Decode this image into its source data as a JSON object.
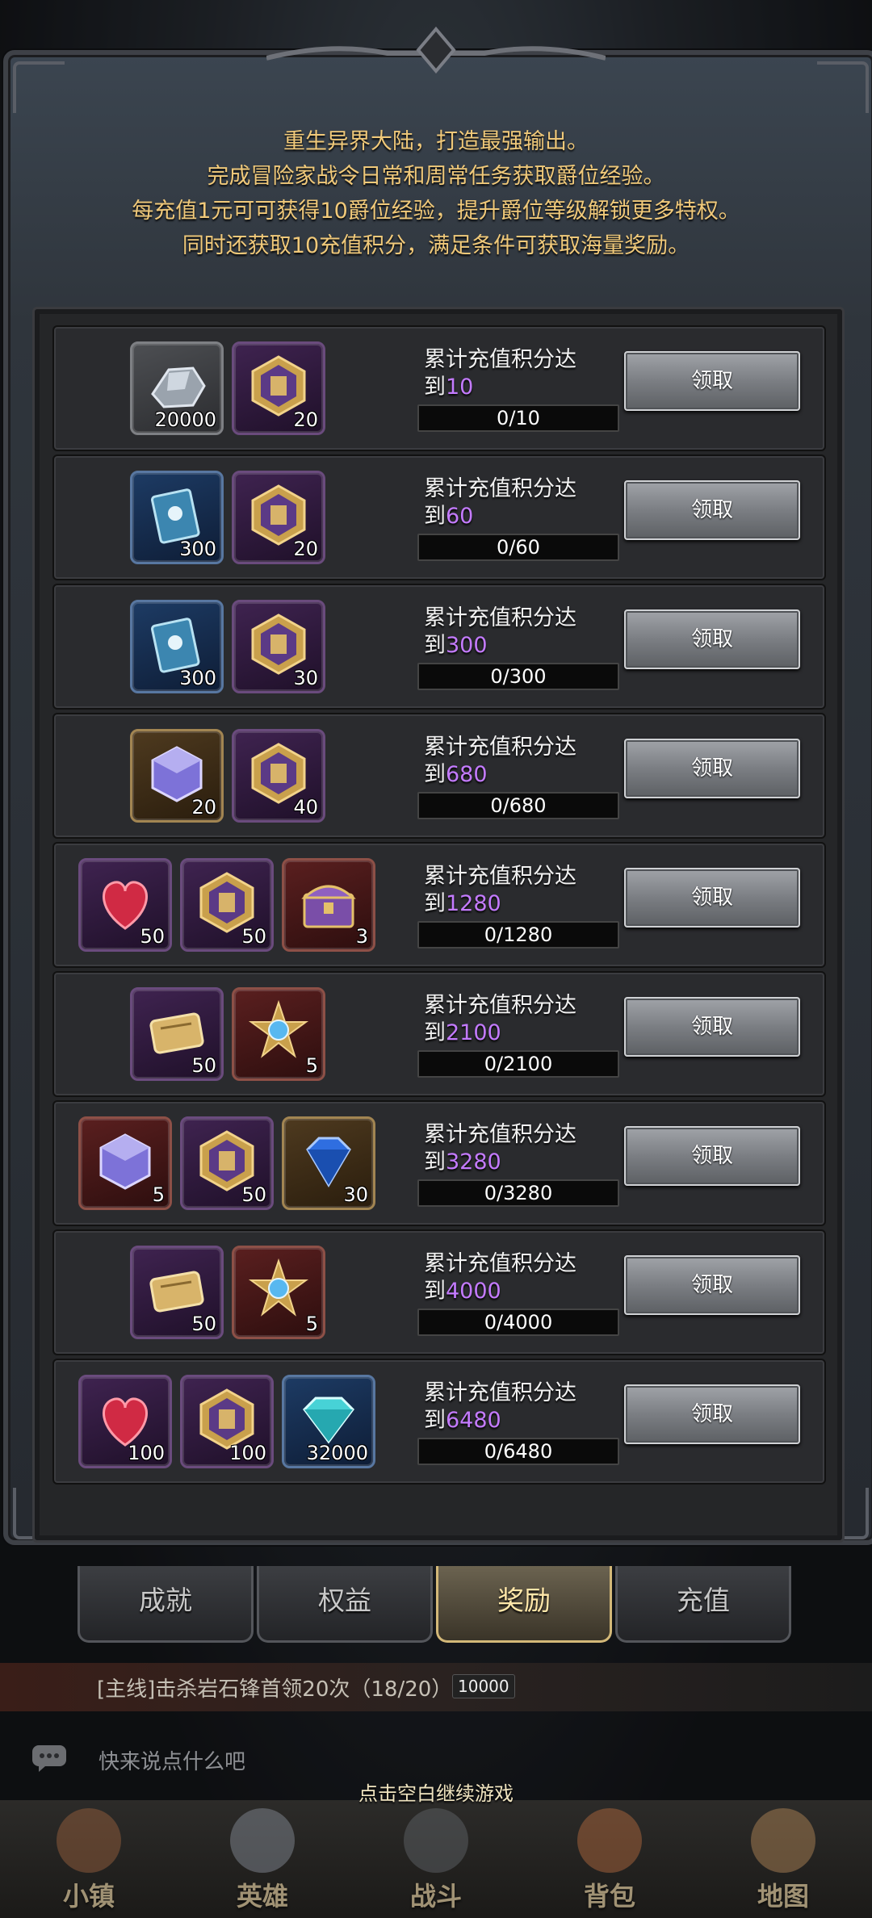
{
  "intro": [
    "重生异界大陆，打造最强输出。",
    "完成冒险家战令日常和周常任务获取爵位经验。",
    "每充值1元可可获得10爵位经验，提升爵位等级解锁更多特权。",
    "同时还获取10充值积分，满足条件可获取海量奖励。"
  ],
  "task_prefix": "累计充值积分达",
  "task_mid": "到",
  "claim_label": "领取",
  "rows": [
    {
      "target": "10",
      "progress": "0/10",
      "items": [
        {
          "icon": "ore-icon",
          "qty": "20000",
          "frame": "gray"
        },
        {
          "icon": "crest-icon",
          "qty": "20",
          "frame": "purple"
        }
      ]
    },
    {
      "target": "60",
      "progress": "0/60",
      "items": [
        {
          "icon": "book-icon",
          "qty": "300",
          "frame": "blue"
        },
        {
          "icon": "crest-icon",
          "qty": "20",
          "frame": "purple"
        }
      ]
    },
    {
      "target": "300",
      "progress": "0/300",
      "items": [
        {
          "icon": "book-icon",
          "qty": "300",
          "frame": "blue"
        },
        {
          "icon": "crest-icon",
          "qty": "30",
          "frame": "purple"
        }
      ]
    },
    {
      "target": "680",
      "progress": "0/680",
      "items": [
        {
          "icon": "cube-icon",
          "qty": "20",
          "frame": "gold"
        },
        {
          "icon": "crest-icon",
          "qty": "40",
          "frame": "purple"
        }
      ]
    },
    {
      "target": "1280",
      "progress": "0/1280",
      "items": [
        {
          "icon": "heart-icon",
          "qty": "50",
          "frame": "purple"
        },
        {
          "icon": "crest-icon",
          "qty": "50",
          "frame": "purple"
        },
        {
          "icon": "chest-icon",
          "qty": "3",
          "frame": "red"
        }
      ]
    },
    {
      "target": "2100",
      "progress": "0/2100",
      "items": [
        {
          "icon": "scroll-icon",
          "qty": "50",
          "frame": "purple"
        },
        {
          "icon": "star-gem-icon",
          "qty": "5",
          "frame": "red"
        }
      ]
    },
    {
      "target": "3280",
      "progress": "0/3280",
      "items": [
        {
          "icon": "cube-icon",
          "qty": "5",
          "frame": "red"
        },
        {
          "icon": "crest-icon",
          "qty": "50",
          "frame": "purple"
        },
        {
          "icon": "sapphire-icon",
          "qty": "30",
          "frame": "gold"
        }
      ]
    },
    {
      "target": "4000",
      "progress": "0/4000",
      "items": [
        {
          "icon": "scroll-icon",
          "qty": "50",
          "frame": "purple"
        },
        {
          "icon": "star-gem-icon",
          "qty": "5",
          "frame": "red"
        }
      ]
    },
    {
      "target": "6480",
      "progress": "0/6480",
      "items": [
        {
          "icon": "heart-icon",
          "qty": "100",
          "frame": "purple"
        },
        {
          "icon": "crest-icon",
          "qty": "100",
          "frame": "purple"
        },
        {
          "icon": "diamond-icon",
          "qty": "32000",
          "frame": "blue"
        }
      ]
    }
  ],
  "tabs": [
    "成就",
    "权益",
    "奖励",
    "充值"
  ],
  "active_tab": "奖励",
  "quest": {
    "text": "[主线]击杀岩石锋首领20次（18/20）",
    "count": "10000"
  },
  "chat_placeholder": "快来说点什么吧",
  "continue_hint": "点击空白继续游戏",
  "nav": [
    "小镇",
    "英雄",
    "战斗",
    "背包",
    "地图"
  ],
  "colors": {
    "intro_text": "#f0c97a",
    "target_text": "#c47bff",
    "active_tab": "#ffe7a9"
  }
}
